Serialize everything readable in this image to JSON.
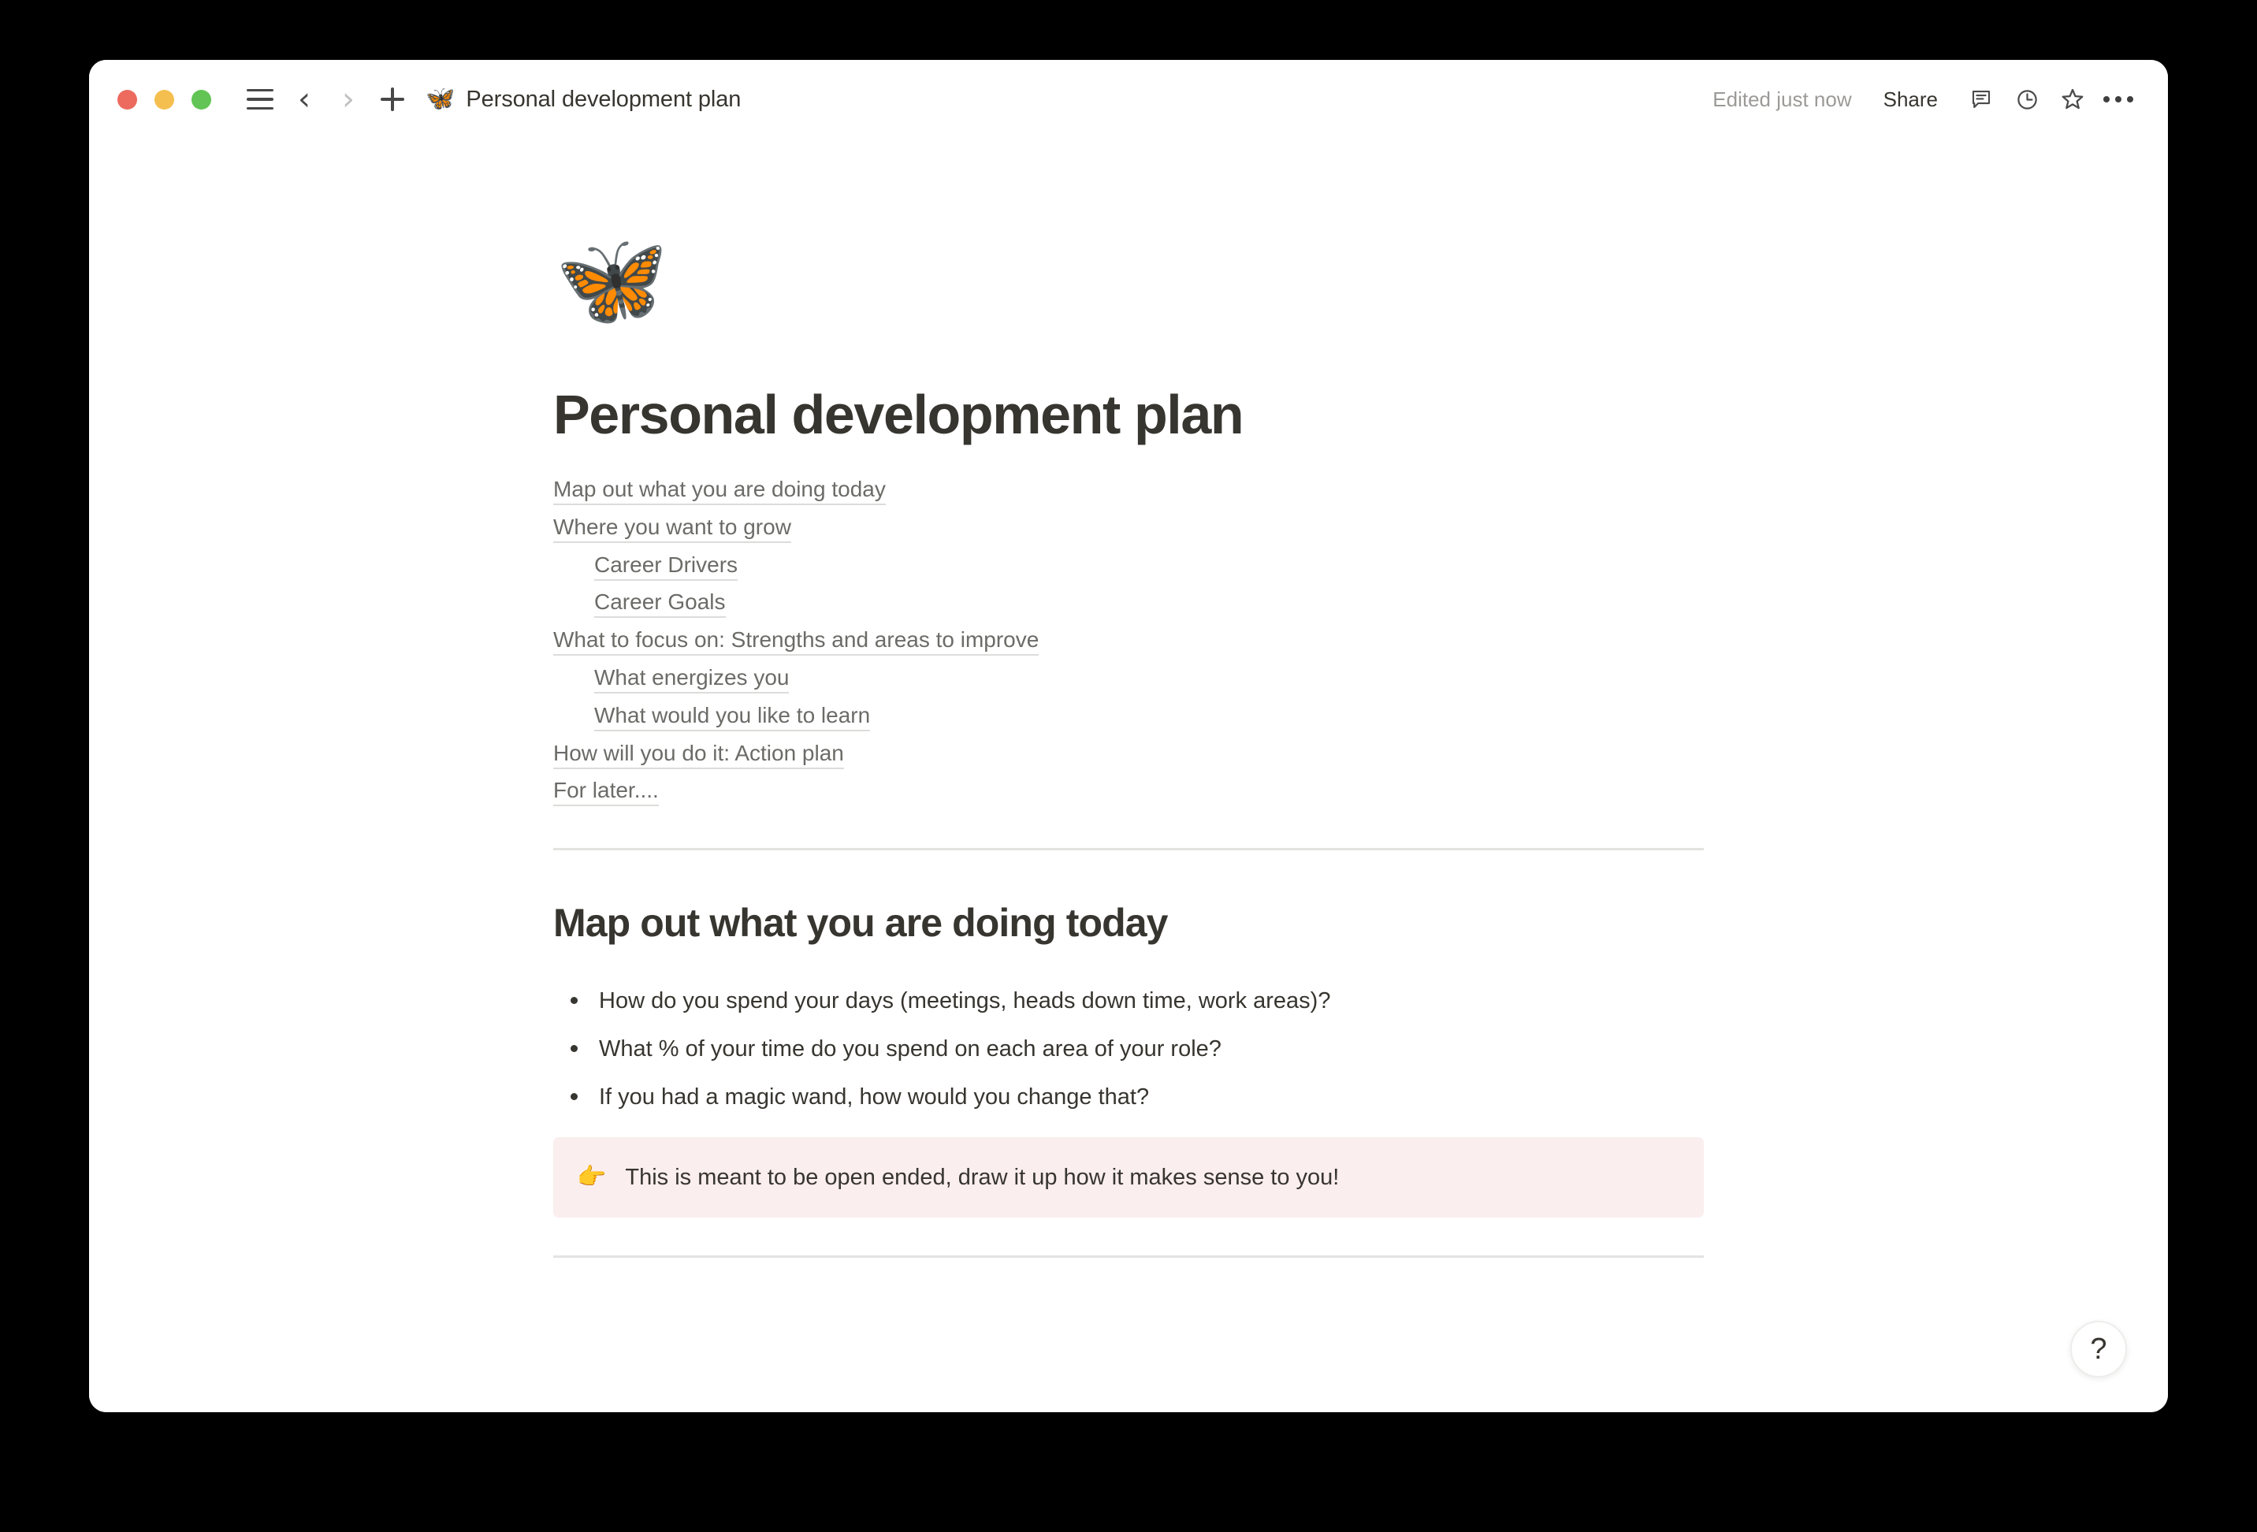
{
  "window": {
    "traffic_lights": [
      {
        "name": "close",
        "color": "#ec6a5e"
      },
      {
        "name": "minimize",
        "color": "#f4bf4f"
      },
      {
        "name": "zoom",
        "color": "#61c454"
      }
    ]
  },
  "titlebar": {
    "doc_emoji": "🦋",
    "doc_title": "Personal development plan",
    "edited_label": "Edited just now",
    "share_label": "Share",
    "icons": [
      "menu-icon",
      "back-icon",
      "forward-icon",
      "plus-icon",
      "comment-icon",
      "history-icon",
      "favorite-icon",
      "more-icon"
    ]
  },
  "page": {
    "icon": "🦋",
    "title": "Personal development plan",
    "toc": [
      {
        "label": "Map out what you are doing today",
        "level": 1
      },
      {
        "label": "Where you want to grow",
        "level": 1
      },
      {
        "label": "Career Drivers",
        "level": 2
      },
      {
        "label": "Career Goals",
        "level": 2
      },
      {
        "label": "What to focus on: Strengths and areas to improve",
        "level": 1
      },
      {
        "label": "What energizes you",
        "level": 2
      },
      {
        "label": "What would you like to learn",
        "level": 2
      },
      {
        "label": "How will you do it: Action plan",
        "level": 1
      },
      {
        "label": "For later....",
        "level": 1
      }
    ],
    "section_heading": "Map out what you are doing today",
    "bullets": [
      "How do you spend your days (meetings, heads down time, work areas)?",
      "What % of your time do you spend on each area of your role?",
      "If you had a magic wand, how would you change that?"
    ],
    "callout": {
      "emoji": "👉",
      "text": "This is meant to be open ended, draw it up how it makes sense to you!",
      "background": "#fbeeee"
    }
  },
  "help": {
    "label": "?"
  }
}
